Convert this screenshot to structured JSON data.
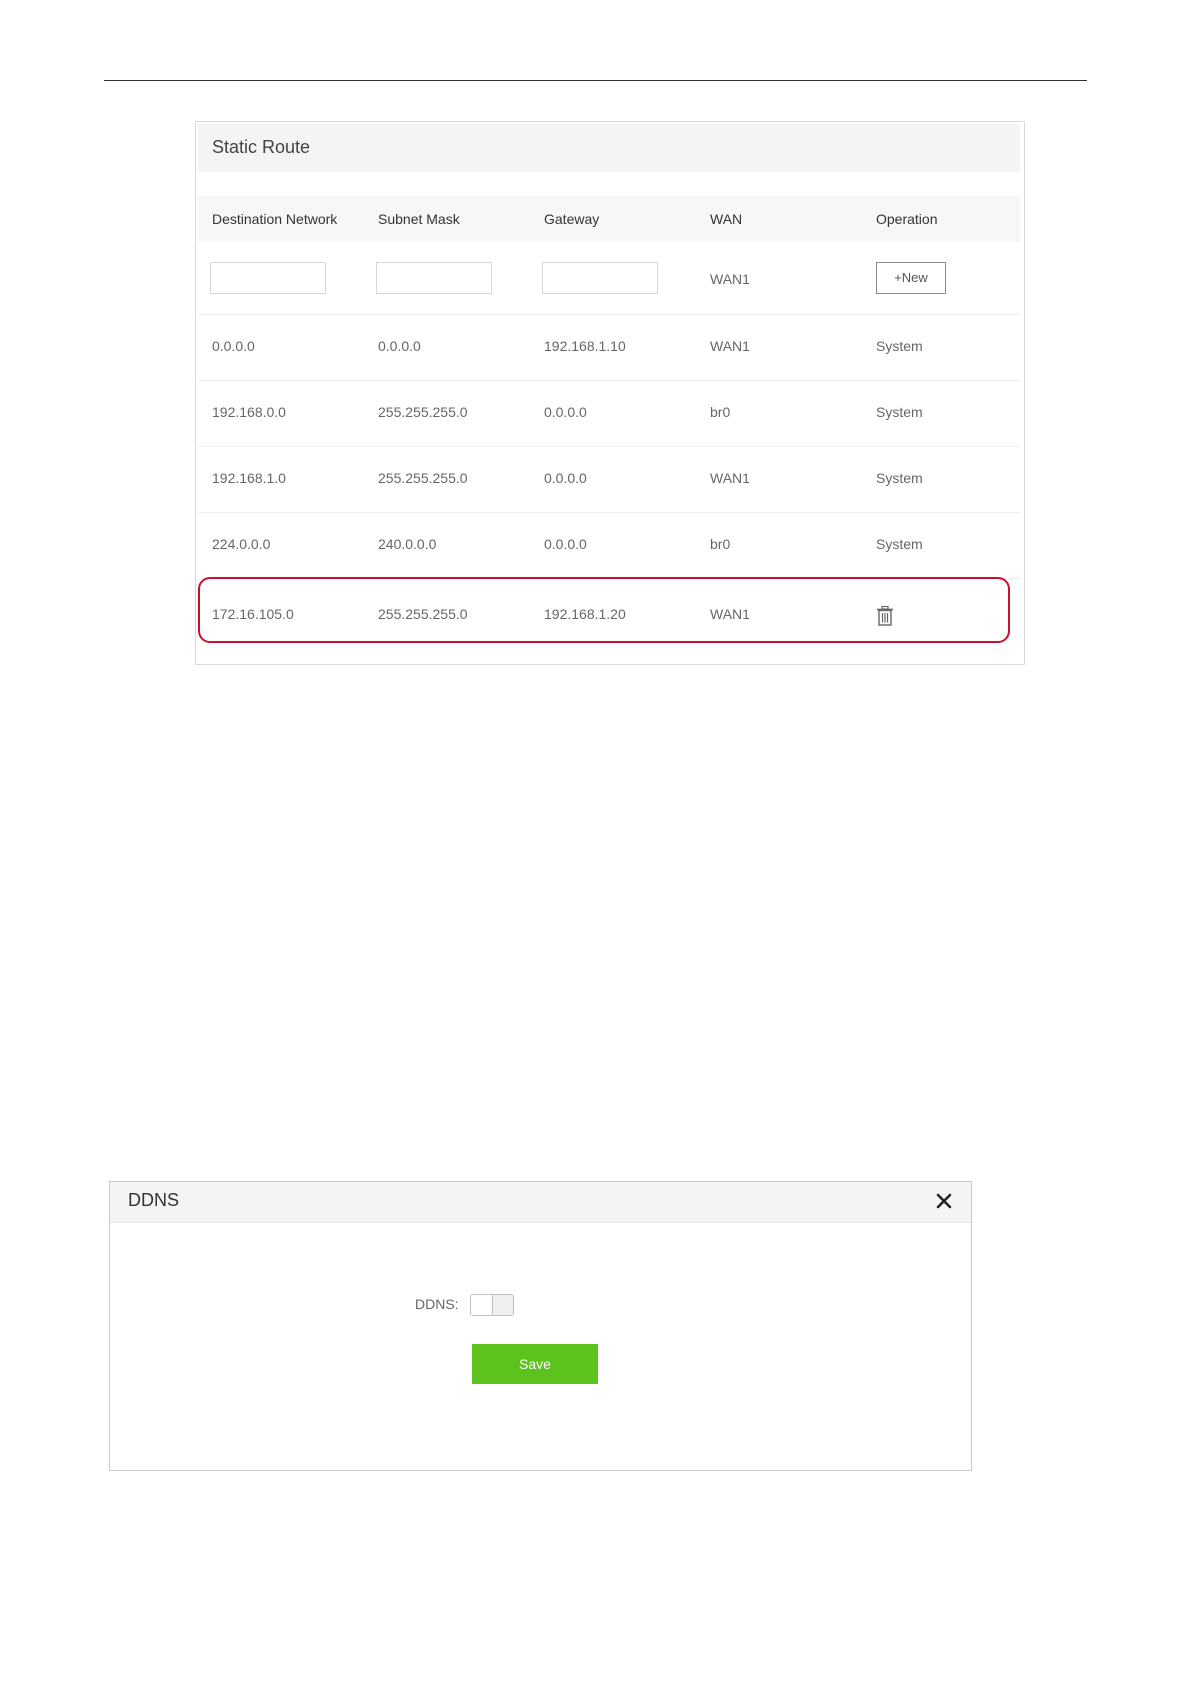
{
  "static_route": {
    "title": "Static Route",
    "columns": [
      "Destination Network",
      "Subnet Mask",
      "Gateway",
      "WAN",
      "Operation"
    ],
    "new_row": {
      "destination_value": "",
      "mask_value": "",
      "gateway_value": "",
      "wan": "WAN1",
      "button_label": "+New"
    },
    "rows": [
      [
        "0.0.0.0",
        "0.0.0.0",
        "192.168.1.10",
        "WAN1",
        "System"
      ],
      [
        "192.168.0.0",
        "255.255.255.0",
        "0.0.0.0",
        "br0",
        "System"
      ],
      [
        "192.168.1.0",
        "255.255.255.0",
        "0.0.0.0",
        "WAN1",
        "System"
      ],
      [
        "224.0.0.0",
        "240.0.0.0",
        "0.0.0.0",
        "br0",
        "System"
      ],
      [
        "172.16.105.0",
        "255.255.255.0",
        "192.168.1.20",
        "WAN1",
        ""
      ]
    ],
    "highlight_color": "#c8102e",
    "delete_icon": "trash-icon"
  },
  "ddns_dialog": {
    "title": "DDNS",
    "close_icon": "close-icon",
    "label": "DDNS:",
    "toggle_state": "off",
    "save_label": "Save",
    "accent_color": "#5cc21c"
  }
}
